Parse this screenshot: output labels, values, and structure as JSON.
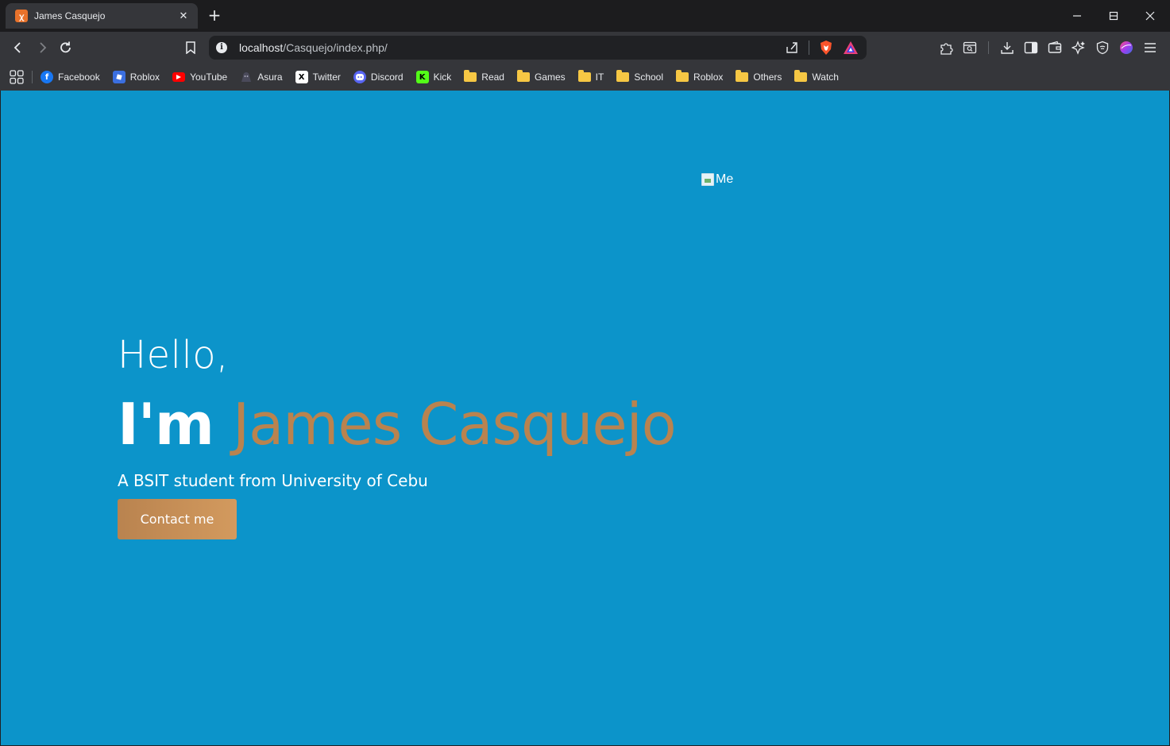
{
  "tab": {
    "title": "James Casquejo",
    "favicon": "xampp-icon"
  },
  "toolbar": {
    "url_host": "localhost",
    "url_path": "/Casquejo/index.php/"
  },
  "bookmarks": [
    {
      "label": "Facebook",
      "icon": "facebook-icon",
      "color": "#1877f2"
    },
    {
      "label": "Roblox",
      "icon": "roblox-icon",
      "color": "#3b6fe0"
    },
    {
      "label": "YouTube",
      "icon": "youtube-icon",
      "color": "#ff0000"
    },
    {
      "label": "Asura",
      "icon": "asura-icon",
      "color": "#4a4a5a"
    },
    {
      "label": "Twitter",
      "icon": "x-icon",
      "color": "#000000"
    },
    {
      "label": "Discord",
      "icon": "discord-icon",
      "color": "#5865f2"
    },
    {
      "label": "Kick",
      "icon": "kick-icon",
      "color": "#53fc18"
    },
    {
      "label": "Read",
      "icon": "folder-icon"
    },
    {
      "label": "Games",
      "icon": "folder-icon"
    },
    {
      "label": "IT",
      "icon": "folder-icon"
    },
    {
      "label": "School",
      "icon": "folder-icon"
    },
    {
      "label": "Roblox",
      "icon": "folder-icon"
    },
    {
      "label": "Others",
      "icon": "folder-icon"
    },
    {
      "label": "Watch",
      "icon": "folder-icon"
    }
  ],
  "page": {
    "image_alt": "Me",
    "greeting": "Hello,",
    "intro_prefix": "I'm",
    "name": "James Casquejo",
    "subtitle": "A BSIT student from University of Cebu",
    "contact_label": "Contact me",
    "colors": {
      "background": "#0c94ca",
      "accent": "#b9834f"
    }
  }
}
